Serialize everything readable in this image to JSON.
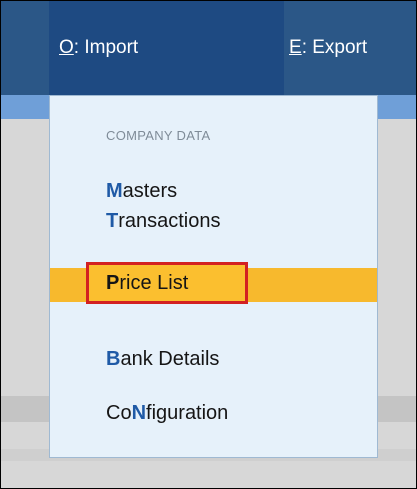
{
  "menubar": {
    "import_menu": {
      "hotkey": "O",
      "separator": ":",
      "label": " Import"
    },
    "export_menu": {
      "hotkey": "E",
      "separator": ":",
      "label": " Export"
    }
  },
  "dropdown": {
    "section_header": "COMPANY DATA",
    "items": [
      {
        "hotkey": "M",
        "rest": "asters"
      },
      {
        "hotkey": "T",
        "rest": "ransactions"
      },
      {
        "hotkey": "P",
        "rest": "rice List"
      },
      {
        "hotkey": "B",
        "rest": "ank Details"
      },
      {
        "before": "Co",
        "hotkey": "N",
        "rest": "figuration"
      }
    ],
    "highlighted_index": 2
  },
  "colors": {
    "menubar": "#2b5787",
    "active_menu": "#1e4a82",
    "dropdown_bg": "#e6f1fa",
    "hotkey": "#1f5aa6",
    "highlight": "#f7b92d",
    "annotation_border": "#d32121"
  }
}
